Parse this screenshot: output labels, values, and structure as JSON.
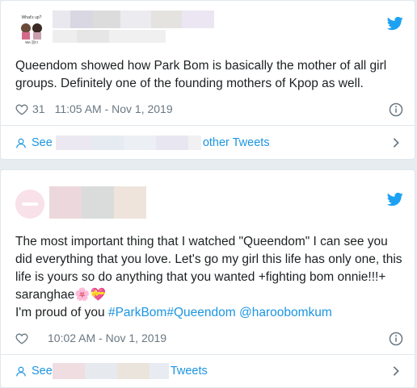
{
  "tweets": [
    {
      "text": "Queendom showed how Park Bom is basically the mother of all girl groups. Definitely one of the founding mothers of Kpop as well.",
      "likes": "31",
      "timestamp": "11:05 AM - Nov 1, 2019",
      "see_label": "See",
      "see_suffix": "other Tweets",
      "avatar_text_1": "What's up?",
      "avatar_text_2": "We 봄!!!"
    },
    {
      "text_main": "The most important thing that I watched \"Queendom\" I can see you did everything that you love. Let's go my girl this life has only one, this life is yours so do anything that you wanted +fighting bom onnie!!!+ saranghae🌸💝",
      "text_line2_plain": "I'm proud of you ",
      "hashtag1": "#ParkBom",
      "hashtag2": "#Queendom",
      "mention": "@haroobomkum",
      "timestamp": "10:02 AM - Nov 1, 2019",
      "see_label": "See",
      "see_suffix": "Tweets"
    }
  ],
  "colors": {
    "link": "#1b95e0",
    "muted": "#697882",
    "text": "#1c2022",
    "border": "#e1e8ed",
    "background": "#e6ecf0"
  },
  "icons": [
    "twitter-bird-icon",
    "heart-icon",
    "info-icon",
    "user-icon",
    "chevron-right-icon"
  ]
}
